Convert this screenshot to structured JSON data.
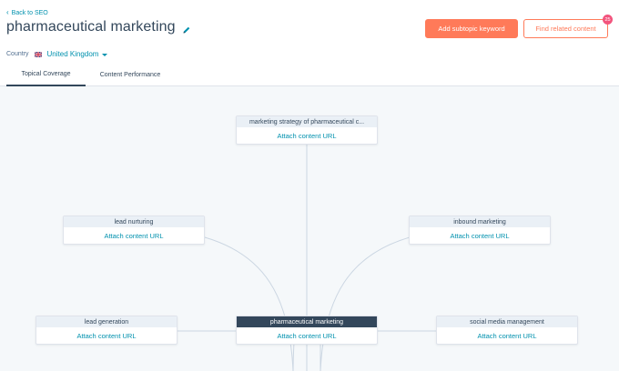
{
  "nav": {
    "back_label": "Back to SEO"
  },
  "header": {
    "title": "pharmaceutical marketing",
    "primary_button": "Add subtopic keyword",
    "secondary_button": "Find related content",
    "badge_count": "25"
  },
  "country": {
    "label": "Country",
    "value": "United Kingdom"
  },
  "tabs": [
    {
      "label": "Topical Coverage",
      "active": true
    },
    {
      "label": "Content Performance",
      "active": false
    }
  ],
  "topic_map": {
    "pillar": {
      "title": "pharmaceutical marketing",
      "action": "Attach content URL"
    },
    "subtopics": [
      {
        "title": "marketing strategy of pharmaceutical c...",
        "action": "Attach content URL"
      },
      {
        "title": "lead nurturing",
        "action": "Attach content URL"
      },
      {
        "title": "inbound marketing",
        "action": "Attach content URL"
      },
      {
        "title": "lead generation",
        "action": "Attach content URL"
      },
      {
        "title": "social media management",
        "action": "Attach content URL"
      }
    ]
  },
  "colors": {
    "accent": "#ff7a59",
    "link": "#0091ae",
    "text": "#33475b",
    "badge": "#f2547d",
    "canvas_bg": "#f5f8fa"
  },
  "icons": [
    "chevron-left-icon",
    "pencil-icon",
    "uk-flag-icon",
    "caret-down-icon"
  ]
}
